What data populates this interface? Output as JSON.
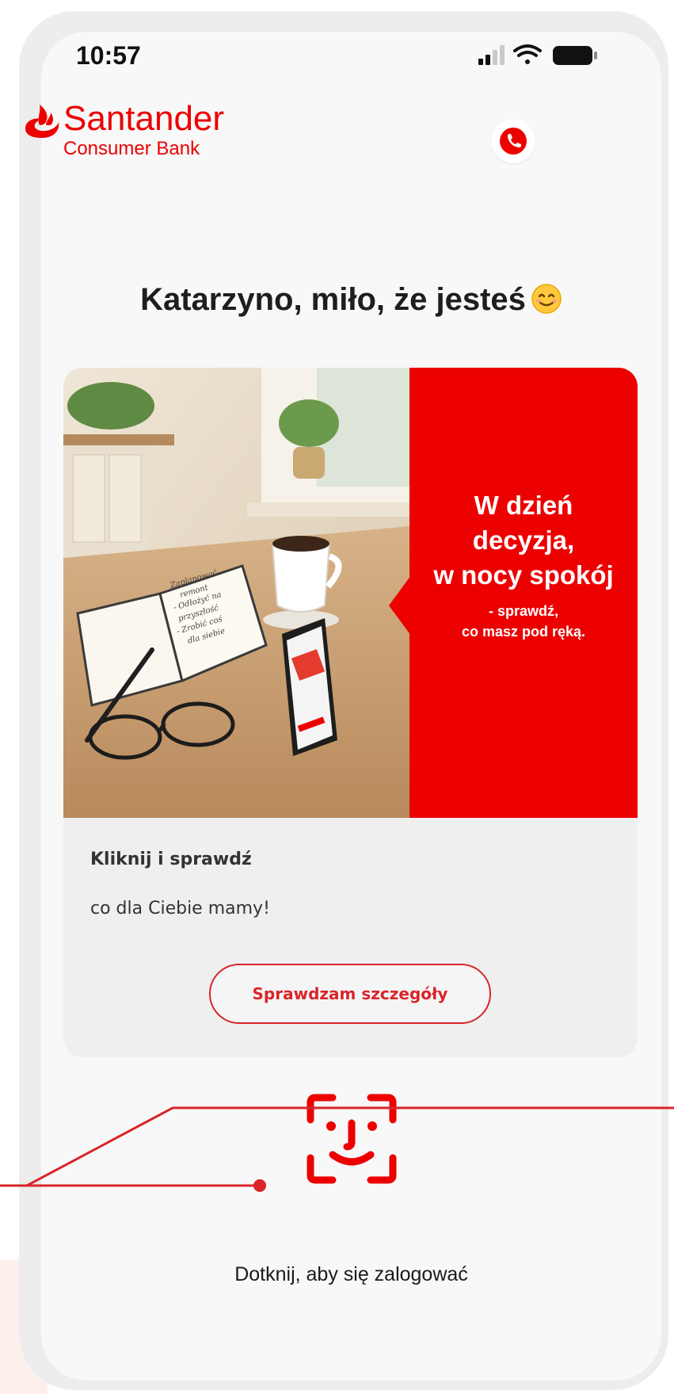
{
  "status_bar": {
    "time": "10:57"
  },
  "header": {
    "brand": "Santander",
    "brand_sub": "Consumer Bank"
  },
  "greeting": "Katarzyno, miło, że jesteś",
  "promo_card": {
    "banner_headline": [
      "W dzień",
      "decyzja,",
      "w nocy spokój"
    ],
    "banner_subline": [
      "- sprawdź,",
      "co masz pod ręką."
    ],
    "notebook_text": [
      "Zaplanować",
      "remont",
      "- Odłożyć na",
      "przyszłość",
      "- Zrobić coś",
      "dla siebie"
    ],
    "title": "Kliknij i sprawdź",
    "description": "co dla Ciebie mamy!",
    "button_label": "Sprawdzam szczegóły"
  },
  "login": {
    "label": "Dotknij, aby się zalogować"
  },
  "colors": {
    "brand_red": "#ec0000",
    "button_red": "#d9252a"
  },
  "icons": [
    "signal-icon",
    "wifi-icon",
    "battery-icon",
    "santander-flame-icon",
    "phone-call-icon",
    "smile-emoji-icon",
    "face-id-icon"
  ]
}
